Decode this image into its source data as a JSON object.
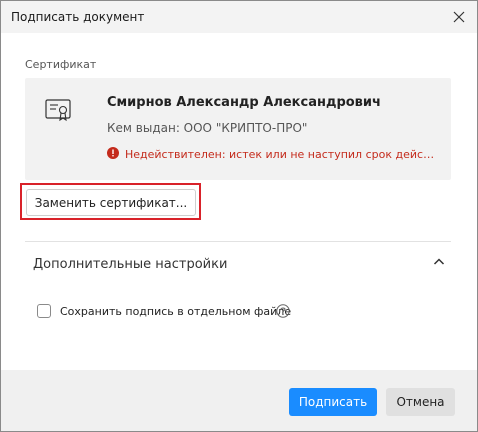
{
  "dialog": {
    "title": "Подписать документ",
    "close_icon": "close-icon"
  },
  "certificate": {
    "section_label": "Сертификат",
    "icon": "certificate-icon",
    "name": "Смирнов Александр Александрович",
    "issuer": "Кем выдан: ООО \"КРИПТО-ПРО\"",
    "status_icon": "error-icon",
    "status": "Недействителен: истек или не наступил срок действия",
    "status_color": "#c42b1c",
    "replace_label": "Заменить сертификат..."
  },
  "advanced": {
    "label": "Дополнительные настройки",
    "chevron_icon": "chevron-up-icon",
    "save_separate_label": "Сохранить подпись в отдельном файле",
    "save_separate_checked": false,
    "help_icon": "help-icon"
  },
  "footer": {
    "sign_label": "Подписать",
    "cancel_label": "Отмена",
    "accent_color": "#1a8cff"
  }
}
